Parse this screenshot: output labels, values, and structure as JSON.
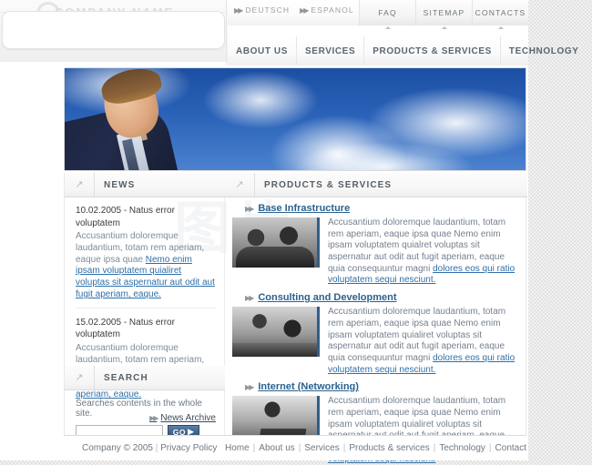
{
  "header": {
    "logo": {
      "watermark_text": "COMPANY NAME",
      "glyph_icon": "circle-logo-icon"
    },
    "lang_links": [
      {
        "label": "DEUTSCH",
        "icon": "double-arrow-icon"
      },
      {
        "label": "ESPANOL",
        "icon": "double-arrow-icon"
      }
    ],
    "tabs": [
      {
        "label": "FAQ"
      },
      {
        "label": "SITEMAP"
      },
      {
        "label": "CONTACTS"
      }
    ],
    "main_nav": [
      {
        "label": "ABOUT US"
      },
      {
        "label": "SERVICES"
      },
      {
        "label": "PRODUCTS & SERVICES"
      },
      {
        "label": "TECHNOLOGY"
      }
    ]
  },
  "hero": {
    "alt": "businessman against blue sky with clouds"
  },
  "watermark": {
    "text": "图片"
  },
  "news": {
    "section_title": "NEWS",
    "section_icon": "arrow-up-right-icon",
    "items": [
      {
        "date": "10.02.2005 - Natus error voluptatem",
        "text": "Accusantium doloremque laudantium, totam rem aperiam, eaque ipsa quae ",
        "link_text": "Nemo enim ipsam voluptatem quialiret voluptas sit aspernatur aut odit aut fugit aperiam, eaque."
      },
      {
        "date": "15.02.2005 - Natus error voluptatem",
        "text": "Accusantium doloremque laudantium, totam rem aperiam, eaque ipsa quae ",
        "link_text": "Nemo enim ipsam voluptatem quialiret fugit aperiam, eaque."
      }
    ],
    "archive_label": "News Archive",
    "archive_icon": "double-arrow-icon"
  },
  "search": {
    "section_title": "SEARCH",
    "section_icon": "arrow-up-right-icon",
    "caption": "Searches contents in the whole site.",
    "input_value": "",
    "input_placeholder": "",
    "button_label": "GO",
    "button_icon": "play-arrow-icon"
  },
  "products": {
    "section_title": "PRODUCTS & SERVICES",
    "section_icon": "arrow-up-right-icon",
    "items": [
      {
        "title": "Base Infrastructure",
        "bullet_icon": "double-arrow-icon",
        "thumb_name": "two-businessmen-photo",
        "text": "Accusantium doloremque laudantium, totam rem aperiam, eaque ipsa quae  Nemo enim ipsam voluptatem quialret voluptas sit aspernatur aut odit aut fugit aperiam, eaque quia consequuntur magni ",
        "link_text": "dolores eos qui ratio voluptatem sequi nesciunt."
      },
      {
        "title": "Consulting and Development",
        "bullet_icon": "double-arrow-icon",
        "thumb_name": "meeting-with-laptop-photo",
        "text": "Accusantium doloremque laudantium, totam rem aperiam, eaque ipsa quae  Nemo enim ipsam voluptatem quialiret voluptas sit aspernatur aut odit aut fugit aperiam, eaque quia consequuntur magni ",
        "link_text": "dolores eos qui ratio voluptatem sequi nesciunt."
      },
      {
        "title": "Internet (Networking)",
        "bullet_icon": "double-arrow-icon",
        "thumb_name": "woman-on-phone-with-laptop-photo",
        "text": "Accusantium doloremque laudantium, totam rem aperiam, eaque ipsa quae  Nemo enim ipsam voluptatem quialiret voluptas sit aspernatur aut odit aut fugit aperiam, eaque quia consequuntur magni ",
        "link_text": "dolores eos qui ratio voluptatem sequi nesciunt."
      }
    ]
  },
  "footer": {
    "copyright": "Company © 2005",
    "privacy_label": "Privacy Policy",
    "divider": "|",
    "links": [
      {
        "label": "Home"
      },
      {
        "label": "About us"
      },
      {
        "label": "Services"
      },
      {
        "label": "Products & services"
      },
      {
        "label": "Technology"
      },
      {
        "label": "Contact"
      }
    ]
  },
  "colors": {
    "accent_blue": "#2b628f",
    "link_blue": "#2f6fa8",
    "text_muted": "#74818f",
    "nav_text": "#5c656d",
    "hero_sky": "#2a62b8",
    "go_button": "#42638a"
  }
}
